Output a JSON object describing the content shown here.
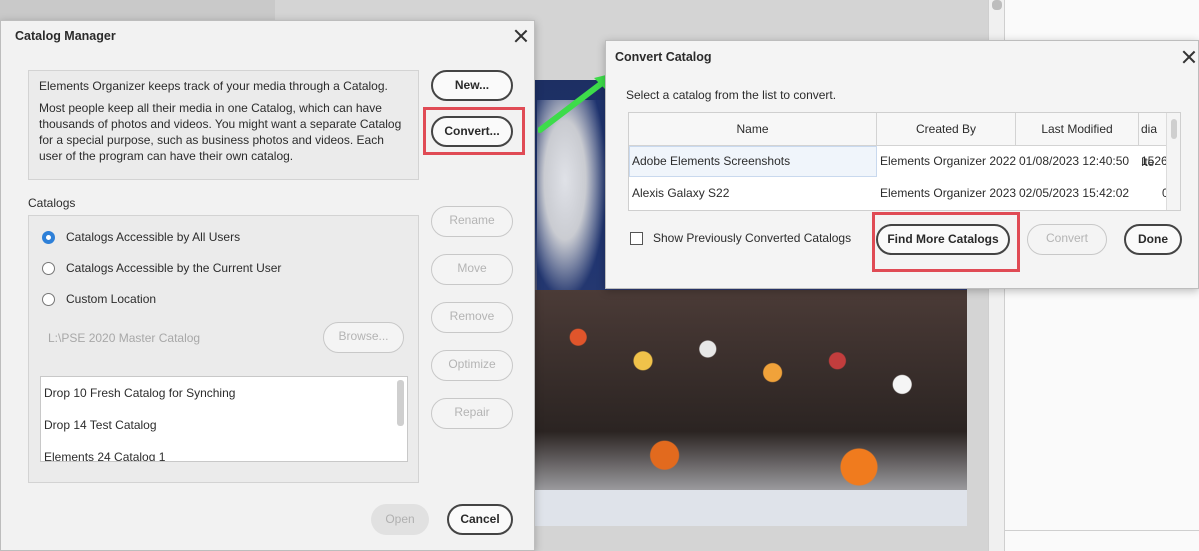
{
  "catalog_manager": {
    "title": "Catalog Manager",
    "info_line1": "Elements Organizer keeps track of your media through a Catalog.",
    "info_line2": "Most people keep all their media in one Catalog, which can have thousands of photos and videos. You might want a separate Catalog for a special purpose, such as business photos and videos. Each user of the program can have their own catalog.",
    "buttons": {
      "new": "New...",
      "convert": "Convert...",
      "rename": "Rename",
      "move": "Move",
      "remove": "Remove",
      "optimize": "Optimize",
      "repair": "Repair",
      "open": "Open",
      "cancel": "Cancel",
      "browse": "Browse..."
    },
    "catalogs_label": "Catalogs",
    "radio_options": [
      {
        "label": "Catalogs Accessible by All Users",
        "selected": true
      },
      {
        "label": "Catalogs Accessible by the Current User",
        "selected": false
      },
      {
        "label": "Custom Location",
        "selected": false
      }
    ],
    "custom_path": "L:\\PSE 2020 Master Catalog",
    "catalog_list": [
      "Drop 10 Fresh Catalog for Synching",
      "Drop 14 Test Catalog",
      "Elements 24 Catalog 1"
    ]
  },
  "convert_catalog": {
    "title": "Convert Catalog",
    "instruction": "Select a catalog from the list to convert.",
    "columns": [
      "Name",
      "Created By",
      "Last Modified",
      "dia Ite"
    ],
    "rows": [
      {
        "name": "Adobe Elements Screenshots",
        "created_by": "Elements Organizer 2022",
        "last_modified": "01/08/2023 12:40:50",
        "items": "1526"
      },
      {
        "name": "Alexis Galaxy S22",
        "created_by": "Elements Organizer 2023",
        "last_modified": "02/05/2023 15:42:02",
        "items": "0"
      }
    ],
    "show_converted_label": "Show Previously Converted Catalogs",
    "buttons": {
      "find_more": "Find More Catalogs",
      "convert": "Convert",
      "done": "Done"
    }
  },
  "colors": {
    "highlight": "#e04b55",
    "arrow": "#3ddc4a",
    "radio_selected": "#2e80d8"
  }
}
